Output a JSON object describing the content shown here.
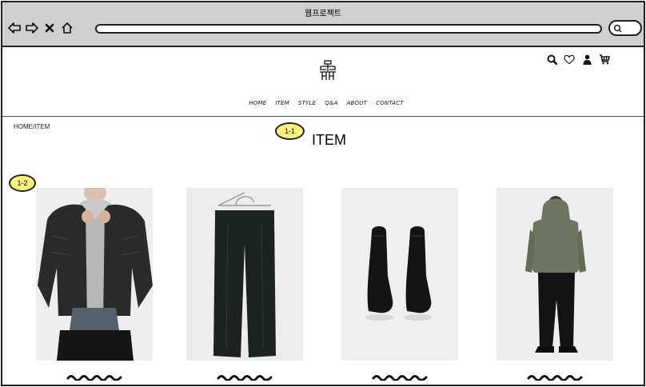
{
  "window": {
    "title": "웹프로젝트"
  },
  "header": {
    "menu": [
      "HOME",
      "ITEM",
      "STYLE",
      "Q&A",
      "ABOUT",
      "CONTACT"
    ],
    "icons": [
      "search-icon",
      "heart-icon",
      "user-icon",
      "cart-icon"
    ]
  },
  "breadcrumb": "HOME/ITEM",
  "page": {
    "title": "ITEM"
  },
  "annotations": {
    "badge_1": "1-1",
    "badge_2": "1-2"
  },
  "products": [
    {
      "image": "padded-jacket-photo",
      "name": ""
    },
    {
      "image": "wide-trousers-photo",
      "name": ""
    },
    {
      "image": "leather-boots-photo",
      "name": ""
    },
    {
      "image": "hooded-parka-outfit-photo",
      "name": ""
    }
  ],
  "colors": {
    "chrome": "#cfcfcf",
    "badge": "#fbf07a",
    "photo_bg": "#ededed"
  }
}
